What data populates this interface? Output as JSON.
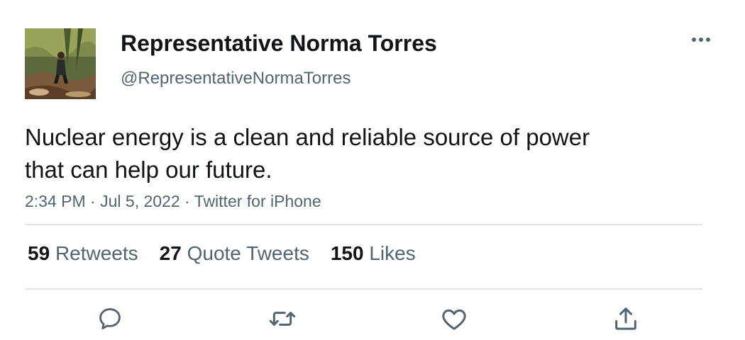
{
  "author": {
    "display_name": "Representative Norma Torres",
    "handle": "@RepresentativeNormaTorres",
    "avatar_icon": "profile-photo-outdoors"
  },
  "tweet": {
    "text_line1": "Nuclear energy is a clean and reliable source of power",
    "text_line2": "that can help our future.",
    "time": "2:34 PM",
    "date": "Jul 5, 2022",
    "source": "Twitter for iPhone",
    "separator": " · "
  },
  "stats": {
    "retweets_count": "59",
    "retweets_label": "Retweets",
    "quotes_count": "27",
    "quotes_label": "Quote Tweets",
    "likes_count": "150",
    "likes_label": "Likes"
  },
  "actions": {
    "reply_icon": "reply-icon",
    "retweet_icon": "retweet-icon",
    "like_icon": "heart-icon",
    "share_icon": "share-icon",
    "more_icon": "more-options-icon"
  },
  "colors": {
    "text_primary": "#0f1419",
    "text_secondary": "#536471",
    "divider": "#e1e5e8",
    "background": "#ffffff"
  }
}
